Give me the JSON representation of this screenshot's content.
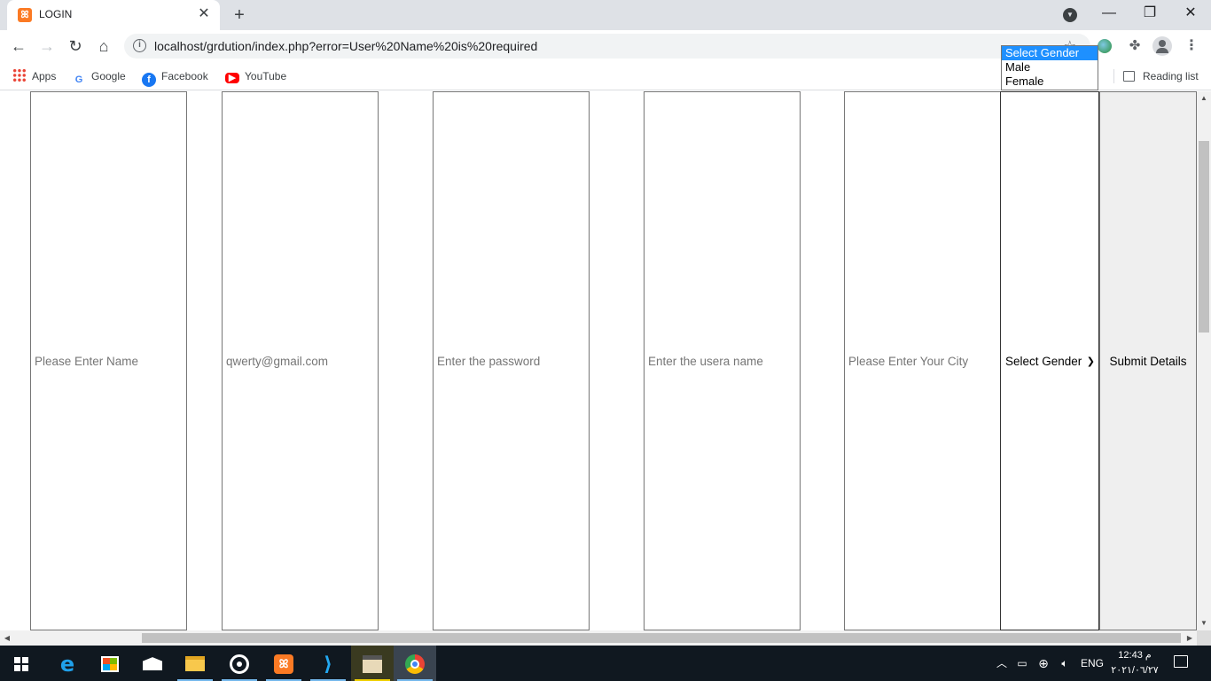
{
  "browser": {
    "tab_title": "LOGIN",
    "url": "localhost/grdution/index.php?error=User%20Name%20is%20required",
    "bookmarks": [
      "Apps",
      "Google",
      "Facebook",
      "YouTube"
    ],
    "reading_list": "Reading list"
  },
  "form": {
    "name_placeholder": "Please Enter Name",
    "email_value": "qwerty@gmail.com",
    "password_placeholder": "Enter the password",
    "username_placeholder": "Enter the usera name",
    "city_placeholder": "Please Enter Your City",
    "gender_selected": "Select Gender",
    "gender_options": [
      "Select Gender",
      "Male",
      "Female"
    ],
    "submit_label": "Submit Details"
  },
  "taskbar": {
    "language": "ENG",
    "time": "12:43 م",
    "date": "٢٠٢١/٠٦/٢٧"
  }
}
